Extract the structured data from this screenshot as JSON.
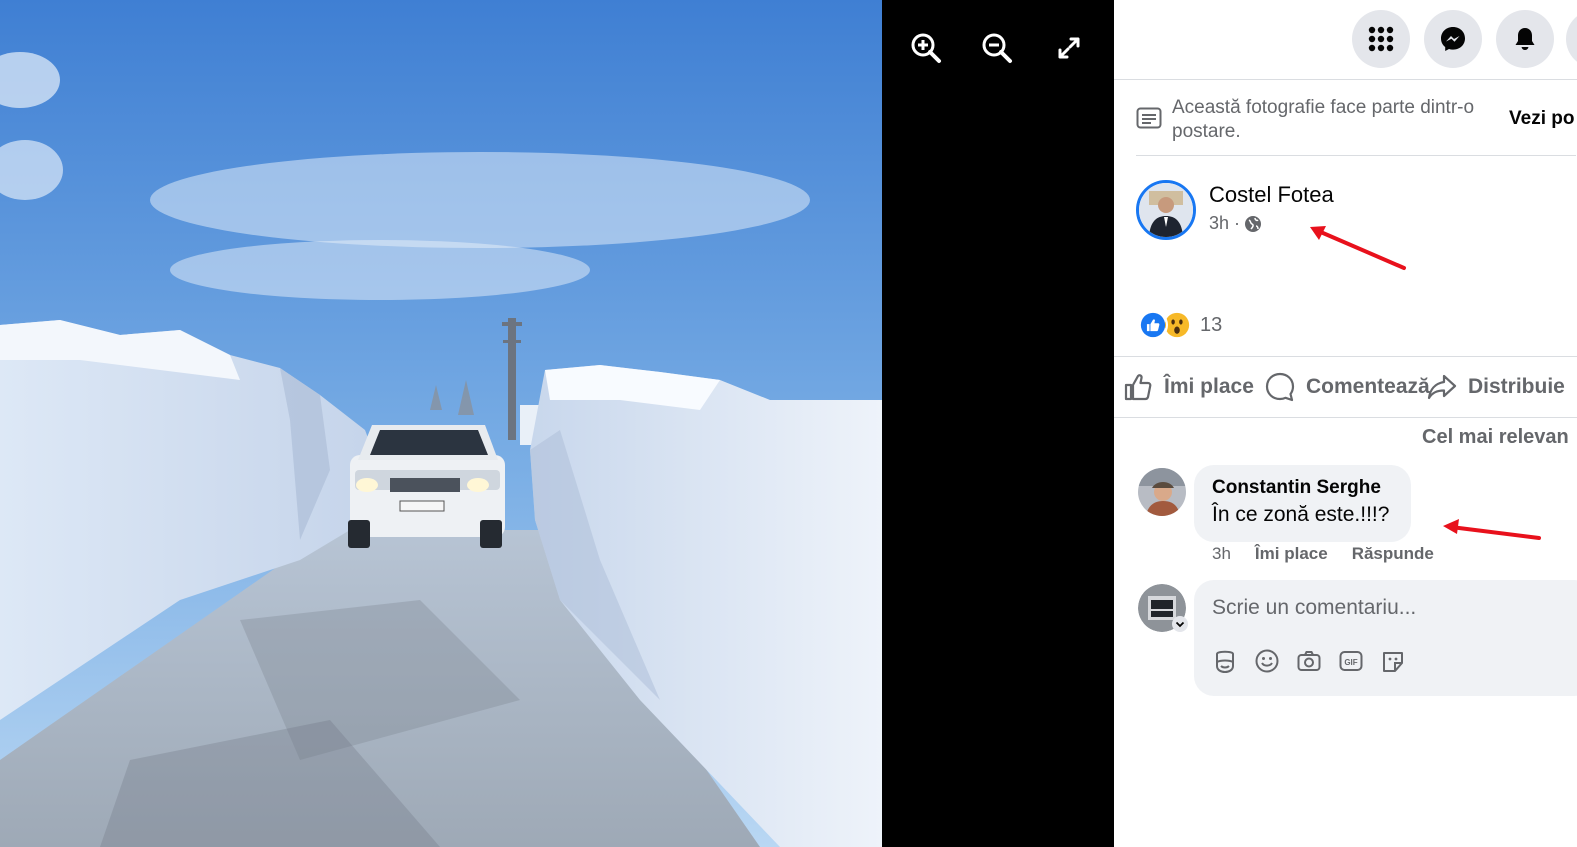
{
  "viewer": {
    "zoom_in_icon": "zoom-in-icon",
    "zoom_out_icon": "zoom-out-icon",
    "fullscreen_icon": "expand-icon"
  },
  "topbar": {
    "icons": [
      "apps-grid-icon",
      "messenger-icon",
      "notifications-bell-icon"
    ]
  },
  "post_note": {
    "text": "Această fotografie face parte dintr-o postare.",
    "link": "Vezi po"
  },
  "post": {
    "author": "Costel Fotea",
    "time": "3h ·",
    "audience_icon": "globe-icon",
    "reaction_count": "13",
    "reaction_icons": [
      "like-reaction-icon",
      "wow-reaction-icon"
    ]
  },
  "actions": {
    "like": "Îmi place",
    "comment": "Comentează",
    "share": "Distribuie"
  },
  "comments_sort": "Cel mai relevan",
  "comment": {
    "author": "Constantin Serghe",
    "text": "În ce zonă este.!!!?",
    "time": "3h",
    "like": "Îmi place",
    "reply": "Răspunde"
  },
  "composer": {
    "placeholder": "Scrie un comentariu...",
    "tools": [
      "avatar-sticker-icon",
      "emoji-icon",
      "camera-icon",
      "gif-icon",
      "sticker-icon"
    ]
  },
  "colors": {
    "accent": "#1877f2",
    "annotation_arrow": "#e8111c",
    "panel_bg": "#ffffff",
    "bubble_bg": "#f0f2f5",
    "secondary_text": "#65676b"
  }
}
